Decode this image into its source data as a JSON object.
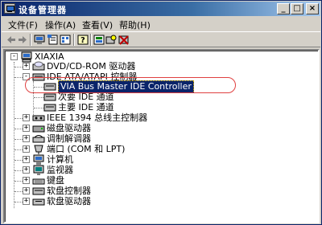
{
  "window": {
    "title": "设备管理器",
    "controls": {
      "minimize": "_",
      "maximize": "□",
      "close": "×"
    }
  },
  "menu": {
    "items": [
      "文件(F)",
      "操作(A)",
      "查看(V)",
      "帮助(H)"
    ]
  },
  "toolbar": {
    "icons": [
      "back-icon",
      "forward-icon",
      "computer-view-icon",
      "properties-icon",
      "help-icon",
      "refresh-icon",
      "scan-hardware-icon",
      "disable-device-icon"
    ]
  },
  "tree": {
    "root": "XIAXIA",
    "items": [
      {
        "label": "DVD/CD-ROM 驱动器",
        "icon": "cdrom-icon",
        "expander": "+"
      },
      {
        "label": "IDE ATA/ATAPI 控制器",
        "icon": "ide-controller-icon",
        "expander": "-"
      },
      {
        "label": "VIA Bus Master IDE Controller",
        "icon": "ide-device-icon",
        "selected": true
      },
      {
        "label": "次要 IDE 通道",
        "icon": "ide-channel-icon"
      },
      {
        "label": "主要 IDE 通道",
        "icon": "ide-channel-icon"
      },
      {
        "label": "IEEE 1394 总线主控制器",
        "icon": "firewire-icon",
        "expander": "+"
      },
      {
        "label": "磁盘驱动器",
        "icon": "disk-icon",
        "expander": "+"
      },
      {
        "label": "调制解调器",
        "icon": "modem-icon",
        "expander": "+"
      },
      {
        "label": "端口 (COM 和 LPT)",
        "icon": "port-icon",
        "expander": "+"
      },
      {
        "label": "计算机",
        "icon": "computer-icon",
        "expander": "+"
      },
      {
        "label": "监视器",
        "icon": "monitor-icon",
        "expander": "+"
      },
      {
        "label": "键盘",
        "icon": "keyboard-icon",
        "expander": "+"
      },
      {
        "label": "软盘控制器",
        "icon": "floppy-controller-icon",
        "expander": "+"
      },
      {
        "label": "软盘驱动器",
        "icon": "floppy-drive-icon",
        "expander": "+"
      }
    ]
  },
  "colors": {
    "title_start": "#0a246a",
    "selection": "#0a246a",
    "annotation": "#e04040"
  }
}
